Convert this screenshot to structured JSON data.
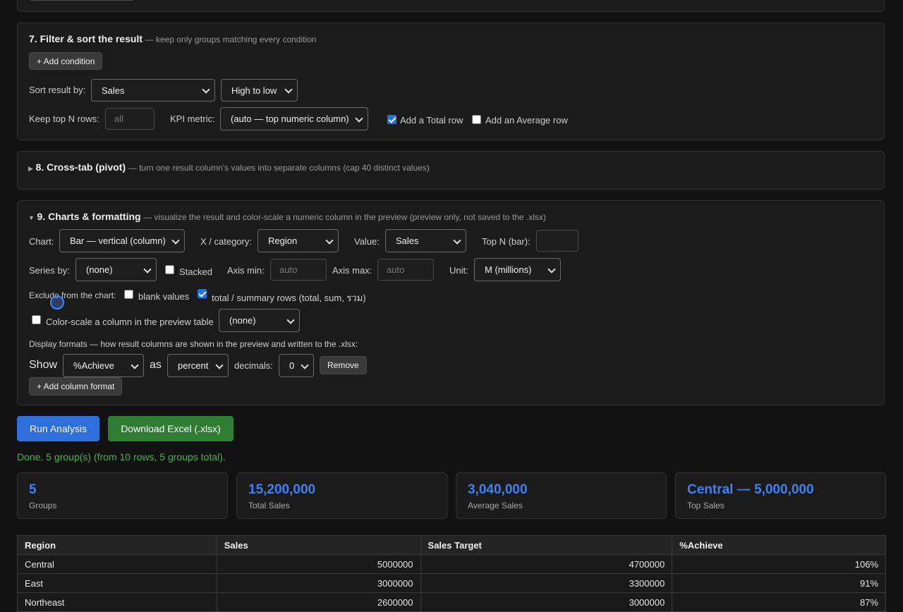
{
  "section7": {
    "title": "7. Filter & sort the result",
    "subtitle": "— keep only groups matching every condition",
    "add_condition": "+ Add condition",
    "sort_label": "Sort result by:",
    "sort_by": "Sales",
    "sort_dir": "High to low",
    "topn_label": "Keep top N rows:",
    "topn_placeholder": "all",
    "kpi_label": "KPI metric:",
    "kpi_value": "(auto — top numeric column)",
    "total_row_label": "Add a Total row",
    "total_row_checked": true,
    "avg_row_label": "Add an Average row",
    "avg_row_checked": false
  },
  "section8": {
    "title": "8. Cross-tab (pivot)",
    "subtitle": "— turn one result column's values into separate columns (cap 40 distinct values)"
  },
  "section9": {
    "title": "9. Charts & formatting",
    "subtitle": "— visualize the result and color-scale a numeric column in the preview (preview only, not saved to the .xlsx)",
    "chart_label": "Chart:",
    "chart_value": "Bar — vertical (column)",
    "xcat_label": "X / category:",
    "xcat_value": "Region",
    "value_label": "Value:",
    "value_value": "Sales",
    "topn_label": "Top N (bar):",
    "series_label": "Series by:",
    "series_value": "(none)",
    "stacked_label": "Stacked",
    "axis_min_label": "Axis min:",
    "axis_min_placeholder": "auto",
    "axis_max_label": "Axis max:",
    "axis_max_placeholder": "auto",
    "unit_label": "Unit:",
    "unit_value": "M (millions)",
    "exclude_label": "Exclude from the chart:",
    "blank_label": "blank values",
    "totals_label": "total / summary rows (total, sum, รวม)",
    "colorscale_label": "Color-scale a column in the preview table",
    "colorscale_value": "(none)",
    "formats_label": "Display formats — how result columns are shown in the preview and written to the .xlsx:",
    "show_label": "Show",
    "format_column": "%Achieve",
    "as_label": "as",
    "format_type": "percent",
    "decimals_label": "decimals:",
    "decimals_value": "0",
    "remove_label": "Remove",
    "add_format_label": "+ Add column format"
  },
  "actions": {
    "run": "Run Analysis",
    "download": "Download Excel (.xlsx)",
    "run_color": "#2f6fdb",
    "download_color": "#2e7d32"
  },
  "status": "Done. 5 group(s) (from 10 rows, 5 groups total).",
  "kpis": [
    {
      "value": "5",
      "label": "Groups"
    },
    {
      "value": "15,200,000",
      "label": "Total Sales"
    },
    {
      "value": "3,040,000",
      "label": "Average Sales"
    },
    {
      "value": "Central — 5,000,000",
      "label": "Top Sales"
    }
  ],
  "table": {
    "headers": [
      "Region",
      "Sales",
      "Sales Target",
      "%Achieve"
    ],
    "rows": [
      [
        "Central",
        "5000000",
        "4700000",
        "106%"
      ],
      [
        "East",
        "3000000",
        "3300000",
        "91%"
      ],
      [
        "Northeast",
        "2600000",
        "3000000",
        "87%"
      ]
    ]
  }
}
